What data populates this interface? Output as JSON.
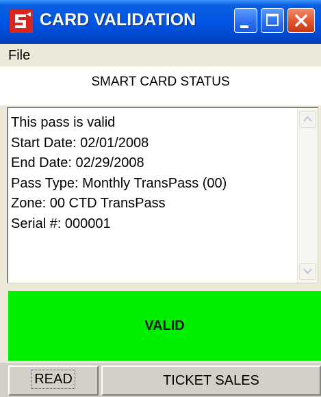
{
  "window": {
    "title": "CARD VALIDATION",
    "title_bar_color": "#0055e5",
    "icon": "app-logo-icon",
    "controls": {
      "minimize_icon": "minimize-icon",
      "maximize_icon": "maximize-icon",
      "close_icon": "close-icon"
    }
  },
  "menubar": {
    "items": [
      "File"
    ]
  },
  "status_header": "SMART CARD STATUS",
  "pass_info": {
    "lines": [
      "This pass is valid",
      "Start Date: 02/01/2008",
      "End Date: 02/29/2008",
      "Pass Type: Monthly TransPass (00)",
      "Zone: 00 CTD TransPass",
      "Serial #: 000001"
    ]
  },
  "validation": {
    "status_text": "VALID",
    "status_color": "#00ee00"
  },
  "buttons": {
    "read_label": "READ",
    "ticket_sales_label": "TICKET SALES"
  }
}
